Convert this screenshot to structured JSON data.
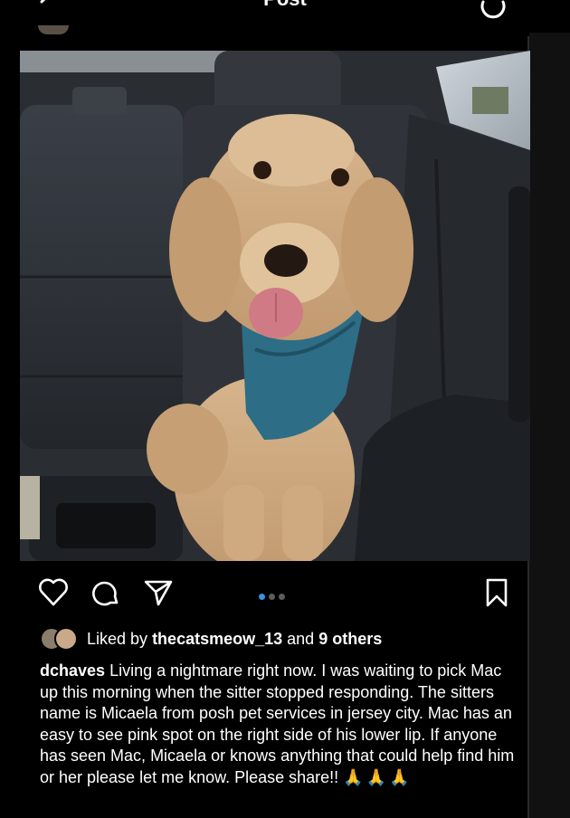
{
  "header": {
    "title": "Post"
  },
  "post": {
    "image_alt": "Golden doodle dog wearing a blue harness sitting in a car back seat",
    "carousel": {
      "count": 3,
      "active_index": 0
    }
  },
  "likes": {
    "prefix": "Liked by ",
    "user": "thecatsmeow_13",
    "middle": " and ",
    "others": "9 others"
  },
  "caption": {
    "username": "dchaves",
    "text": "Living a nightmare right now. I was waiting to pick Mac up this morning when the sitter stopped responding. The sitters name is Micaela from posh pet services in jersey city. Mac has an easy to see pink spot on the right side of his lower lip. If anyone has seen Mac, Micaela or knows anything that could help find him or her please let me know. Please share!!",
    "emoji": "🙏🙏🙏"
  },
  "colors": {
    "background": "#000000",
    "text": "#ffffff",
    "carousel_active": "#3d8fe0",
    "carousel_inactive": "#5c5c5c"
  },
  "icons": [
    "back-chevron-icon",
    "refresh-icon",
    "heart-icon",
    "comment-icon",
    "share-icon",
    "bookmark-icon"
  ]
}
